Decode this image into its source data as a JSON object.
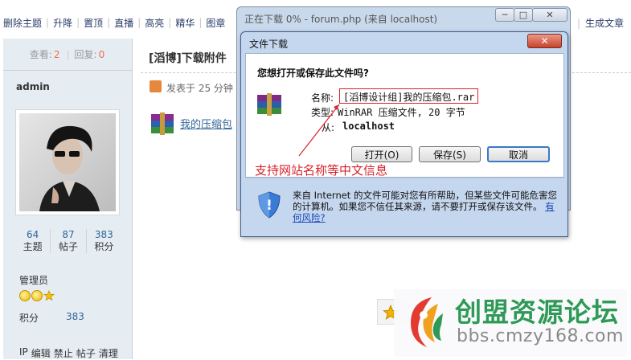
{
  "toolbar": {
    "left_items": [
      "删除主题",
      "升降",
      "置顶",
      "直播",
      "高亮",
      "精华",
      "图章"
    ],
    "right_items": [
      "生成文章"
    ]
  },
  "user_panel": {
    "views_label": "查看:",
    "views_value": "2",
    "replies_label": "回复:",
    "replies_value": "0",
    "username": "admin",
    "counts": [
      {
        "value": "64",
        "label": "主题"
      },
      {
        "value": "87",
        "label": "帖子"
      },
      {
        "value": "383",
        "label": "积分"
      }
    ],
    "role": "管理员",
    "points_label": "积分",
    "points_value": "383",
    "admin_links": [
      "IP",
      "编辑",
      "禁止",
      "帖子",
      "清理"
    ]
  },
  "post": {
    "title": "[滔博]下载附件",
    "meta": "发表于  25 分钟",
    "attachment": "我的压缩包"
  },
  "bg_window": {
    "title": "正在下载 0% - forum.php (来自 localhost)",
    "minimize": "─",
    "maximize": "□",
    "close": "✕"
  },
  "dialog": {
    "title": "文件下载",
    "close": "✕",
    "question": "您想打开或保存此文件吗?",
    "name_label": "名称:",
    "name_value": "[滔博设计组]我的压缩包.rar",
    "type_label": "类型:",
    "type_value": "WinRAR 压缩文件, 20 字节",
    "from_label": "从:",
    "from_value": "localhost",
    "open_button": "打开(O)",
    "save_button": "保存(S)",
    "cancel_button": "取消",
    "warning": "来自 Internet 的文件可能对您有所帮助，但某些文件可能危害您的计算机。如果您不信任其来源，请不要打开或保存该文件。",
    "warning_link": "有何风险?"
  },
  "annotation": "支持网站名称等中文信息",
  "watermark": {
    "title": "创盟资源论坛",
    "url": "bbs.cmzy168.com"
  },
  "colors": {
    "accent_red": "#d8222b",
    "link_blue": "#336699",
    "watermark_green": "#2f9a57"
  }
}
